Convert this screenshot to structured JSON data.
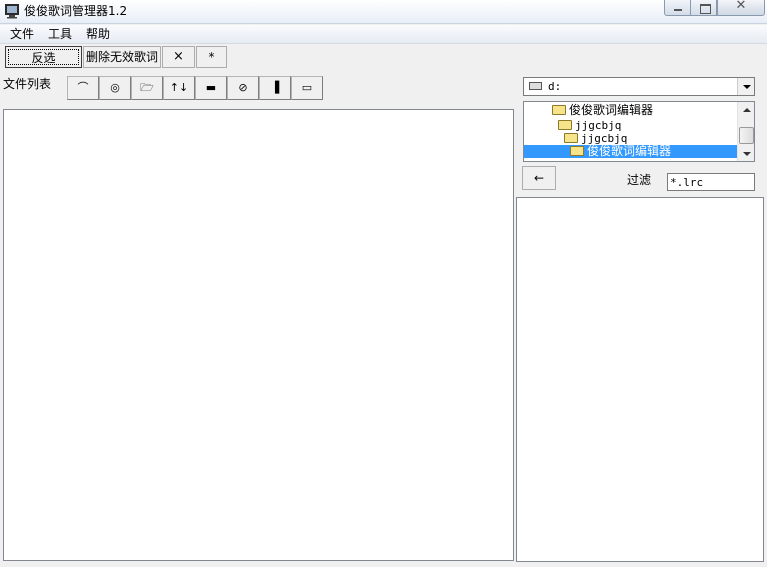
{
  "window": {
    "title": "俊俊歌词管理器1.2",
    "close_glyph": "✕"
  },
  "menu": [
    "文件",
    "工具",
    "帮助"
  ],
  "toolbar": {
    "invert_select": "反选",
    "delete_invalid": "删除无效歌词",
    "close_symbol": "×",
    "star_symbol": "*"
  },
  "file_list": {
    "label": "文件列表",
    "buttons": [
      "⌒",
      "◎",
      "🗁",
      "↑↓",
      "▬",
      "⊘",
      "▐",
      "▭"
    ]
  },
  "drive": {
    "value": "d:"
  },
  "directories": [
    {
      "name": "俊俊歌词编辑器",
      "selected": false
    },
    {
      "name": "jjgcbjq",
      "selected": false
    },
    {
      "name": "jjgcbjq",
      "selected": false
    },
    {
      "name": "俊俊歌词编辑器",
      "selected": true
    }
  ],
  "back_button": "←",
  "filter": {
    "label": "过滤",
    "value": "*.lrc"
  }
}
